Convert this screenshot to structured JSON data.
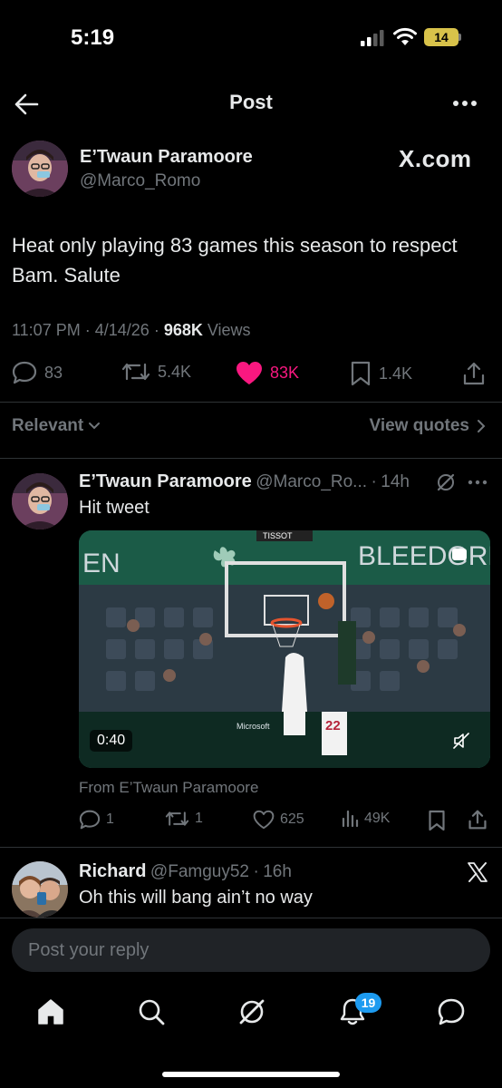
{
  "status_bar": {
    "time": "5:19",
    "battery": "14"
  },
  "header": {
    "title": "Post"
  },
  "post": {
    "author_name": "E’Twaun Paramoore",
    "author_handle": "@Marco_Romo",
    "source_logo": "X.com",
    "text": "Heat only playing 83 games this season to respect Bam. Salute",
    "time": "11:07 PM",
    "date": "4/14/26",
    "views_count": "968K",
    "views_label": "Views",
    "replies": "83",
    "reposts": "5.4K",
    "likes": "83K",
    "bookmarks": "1.4K",
    "like_color": "#f91880"
  },
  "filter": {
    "sort_label": "Relevant",
    "quotes_label": "View quotes"
  },
  "replies": [
    {
      "name": "E’Twaun Paramoore",
      "handle": "@Marco_Ro...",
      "age": "14h",
      "text": "Hit tweet",
      "video": {
        "duration": "0:40",
        "overlay_brand": "BLEEDGREEN",
        "sponsor": "TISSOT",
        "court_sponsor": "Microsoft",
        "jersey_number": "22"
      },
      "from_label": "From E’Twaun Paramoore",
      "stats": {
        "replies": "1",
        "reposts": "1",
        "likes": "625",
        "views": "49K"
      }
    },
    {
      "name": "Richard",
      "handle": "@Famguy52",
      "age": "16h",
      "text": "Oh this will bang ain’t no way"
    }
  ],
  "composer": {
    "placeholder": "Post your reply"
  },
  "tab_bar": {
    "notifications_badge": "19"
  },
  "colors": {
    "background": "#000000",
    "accent": "#1d9bf0",
    "muted": "#71767b",
    "like": "#f91880"
  }
}
